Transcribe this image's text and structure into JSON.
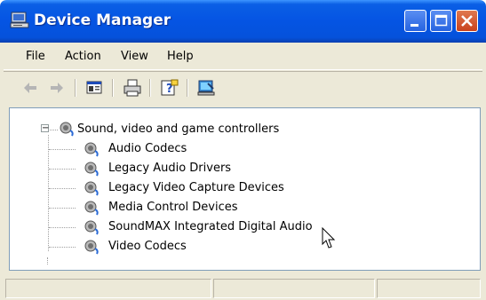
{
  "window": {
    "title": "Device Manager"
  },
  "menu": [
    "File",
    "Action",
    "View",
    "Help"
  ],
  "toolbar": {
    "icons": [
      "back-arrow-icon",
      "forward-arrow-icon",
      "properties-icon",
      "print-icon",
      "help-icon",
      "scan-hardware-icon"
    ]
  },
  "tree": {
    "root": {
      "label": "Sound, video and game controllers",
      "expander": "−",
      "children": [
        "Audio Codecs",
        "Legacy Audio Drivers",
        "Legacy Video Capture Devices",
        "Media Control Devices",
        "SoundMAX Integrated Digital Audio",
        "Video Codecs"
      ]
    }
  },
  "colors": {
    "titlebar": "#0554e3",
    "close_button": "#c9421d",
    "window_face": "#ece9d8"
  }
}
